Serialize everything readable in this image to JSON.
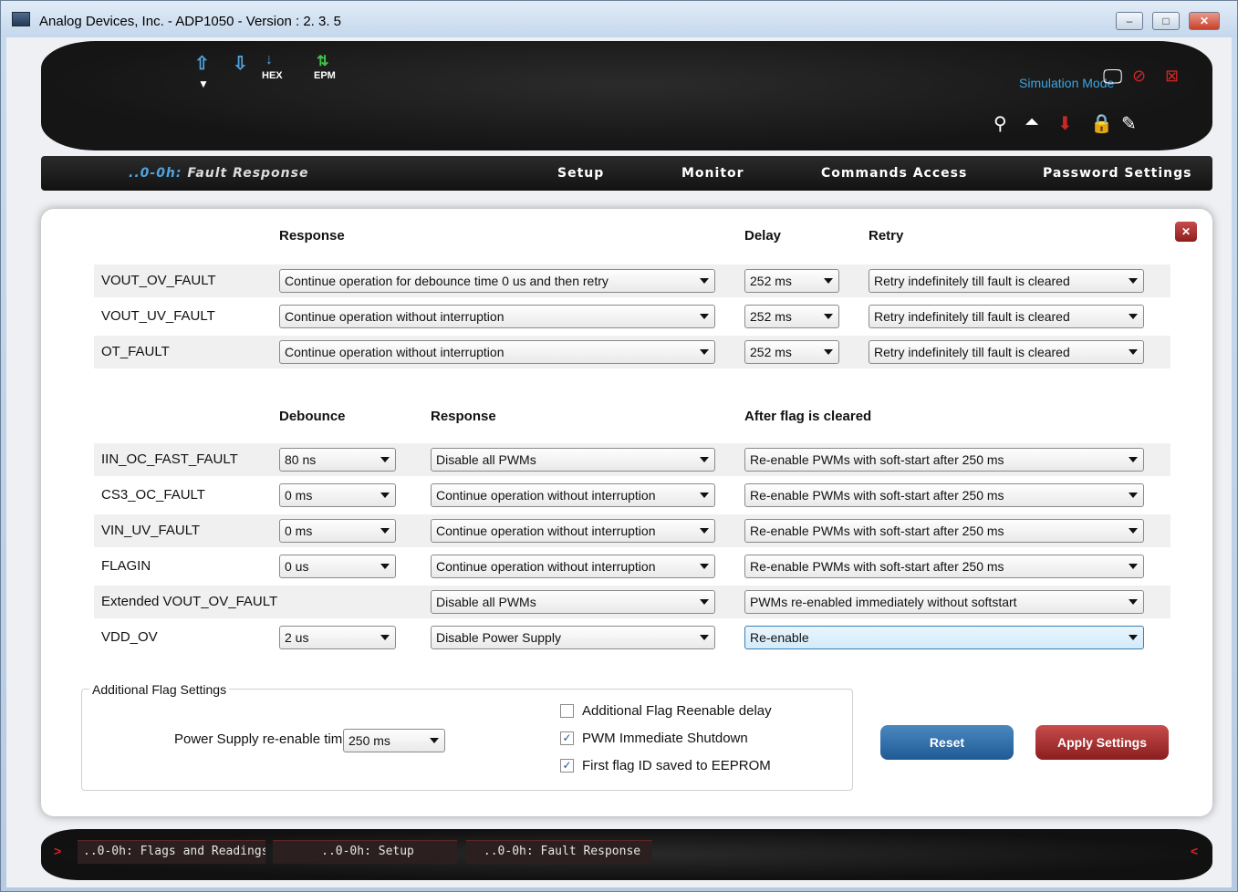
{
  "window": {
    "title": "Analog Devices, Inc. - ADP1050 - Version :  2. 3. 5"
  },
  "toolbar": {
    "hex_label": "HEX",
    "epm_label": "EPM",
    "sim_mode": "Simulation Mode"
  },
  "nav": {
    "current_prefix": "..0-0h:",
    "current_page": "Fault Response",
    "tabs": [
      "Setup",
      "Monitor",
      "Commands Access",
      "Password Settings"
    ]
  },
  "section1": {
    "headers": {
      "response": "Response",
      "delay": "Delay",
      "retry": "Retry"
    },
    "rows": [
      {
        "label": "VOUT_OV_FAULT",
        "response": "Continue operation for debounce time 0 us and then retry",
        "delay": "252 ms",
        "retry": "Retry indefinitely till fault is cleared"
      },
      {
        "label": "VOUT_UV_FAULT",
        "response": "Continue operation without interruption",
        "delay": "252 ms",
        "retry": "Retry indefinitely till fault is cleared"
      },
      {
        "label": "OT_FAULT",
        "response": "Continue operation without interruption",
        "delay": "252 ms",
        "retry": "Retry indefinitely till fault is cleared"
      }
    ]
  },
  "section2": {
    "headers": {
      "debounce": "Debounce",
      "response": "Response",
      "after": "After flag is cleared"
    },
    "rows": [
      {
        "label": "IIN_OC_FAST_FAULT",
        "debounce": "80 ns",
        "response": "Disable all PWMs",
        "after": "Re-enable PWMs with soft-start after 250 ms"
      },
      {
        "label": "CS3_OC_FAULT",
        "debounce": "0 ms",
        "response": "Continue operation without interruption",
        "after": "Re-enable PWMs with soft-start after 250 ms"
      },
      {
        "label": "VIN_UV_FAULT",
        "debounce": "0 ms",
        "response": "Continue operation without interruption",
        "after": "Re-enable PWMs with soft-start after 250 ms"
      },
      {
        "label": "FLAGIN",
        "debounce": "0 us",
        "response": "Continue operation without interruption",
        "after": "Re-enable PWMs with soft-start after 250 ms"
      },
      {
        "label": "Extended VOUT_OV_FAULT",
        "debounce": "",
        "response": "Disable all PWMs",
        "after": "PWMs re-enabled immediately without softstart"
      },
      {
        "label": "VDD_OV",
        "debounce": "2 us",
        "response": "Disable Power Supply",
        "after": "Re-enable"
      }
    ]
  },
  "additional": {
    "legend": "Additional Flag Settings",
    "ps_label": "Power Supply re-enable time",
    "ps_value": "250 ms",
    "checks": [
      {
        "label": "Additional Flag Reenable delay",
        "checked": false
      },
      {
        "label": "PWM Immediate Shutdown",
        "checked": true
      },
      {
        "label": "First flag ID saved to EEPROM",
        "checked": true
      }
    ]
  },
  "buttons": {
    "reset": "Reset",
    "apply": "Apply Settings"
  },
  "bottom_tabs": [
    "..0-0h: Flags and Readings",
    "..0-0h: Setup",
    "..0-0h: Fault Response"
  ],
  "colors": {
    "accent_blue": "#3aa7e6",
    "apply_red": "#8b1e1e",
    "reset_blue": "#1f5a95"
  }
}
